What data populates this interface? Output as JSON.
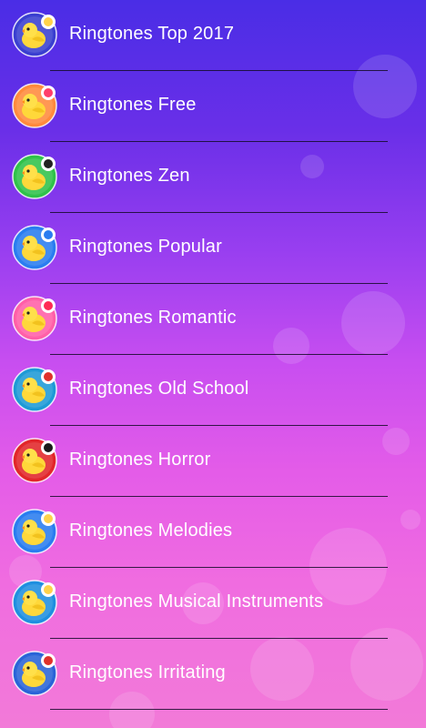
{
  "items": [
    {
      "label": "Ringtones Top 2017",
      "icon": "trophy-icon",
      "bg": "#3a3fd0",
      "badge": "#ffd24a"
    },
    {
      "label": "Ringtones Free",
      "icon": "music-note-icon",
      "bg": "#ff8a3d",
      "badge": "#ff3f6a"
    },
    {
      "label": "Ringtones Zen",
      "icon": "yin-yang-icon",
      "bg": "#2fc24a",
      "badge": "#222222"
    },
    {
      "label": "Ringtones Popular",
      "icon": "thumbs-up-icon",
      "bg": "#2a7df0",
      "badge": "#2a7df0"
    },
    {
      "label": "Ringtones Romantic",
      "icon": "heart-icon",
      "bg": "#ff5fa8",
      "badge": "#ff2b55"
    },
    {
      "label": "Ringtones Old School",
      "icon": "telephone-icon",
      "bg": "#1e9ad6",
      "badge": "#e0312b"
    },
    {
      "label": "Ringtones Horror",
      "icon": "bat-icon",
      "bg": "#e2262a",
      "badge": "#1a1a1a"
    },
    {
      "label": "Ringtones Melodies",
      "icon": "sheet-music-icon",
      "bg": "#2a7df0",
      "badge": "#ffd24a"
    },
    {
      "label": "Ringtones Musical Instruments",
      "icon": "guitar-icon",
      "bg": "#1f8fe0",
      "badge": "#ffd24a"
    },
    {
      "label": "Ringtones Irritating",
      "icon": "alarm-icon",
      "bg": "#2a64d8",
      "badge": "#e0312b"
    }
  ]
}
